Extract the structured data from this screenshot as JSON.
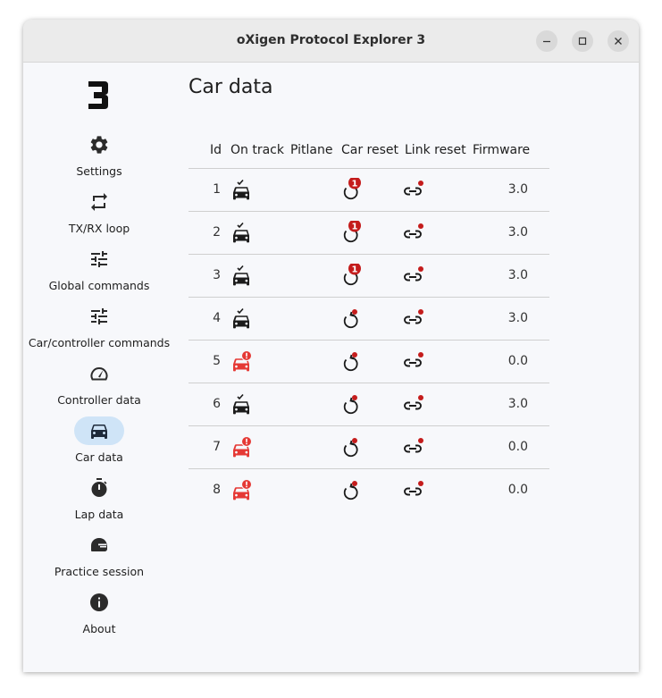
{
  "window": {
    "title": "oXigen Protocol Explorer 3"
  },
  "sidebar": {
    "items": [
      {
        "label": "Settings",
        "icon": "gear-icon"
      },
      {
        "label": "TX/RX loop",
        "icon": "repeat-icon"
      },
      {
        "label": "Global commands",
        "icon": "sliders-icon"
      },
      {
        "label": "Car/controller commands",
        "icon": "sliders-icon"
      },
      {
        "label": "Controller data",
        "icon": "speedometer-icon"
      },
      {
        "label": "Car data",
        "icon": "car-icon",
        "active": true
      },
      {
        "label": "Lap data",
        "icon": "stopwatch-icon"
      },
      {
        "label": "Practice session",
        "icon": "helmet-icon"
      },
      {
        "label": "About",
        "icon": "info-icon"
      }
    ]
  },
  "main": {
    "title": "Car data",
    "columns": [
      "Id",
      "On track",
      "Pitlane",
      "Car reset",
      "Link reset",
      "Firmware"
    ],
    "rows": [
      {
        "id": "1",
        "on_track": true,
        "car_reset_badge": "1",
        "firmware": "3.0"
      },
      {
        "id": "2",
        "on_track": true,
        "car_reset_badge": "1",
        "firmware": "3.0"
      },
      {
        "id": "3",
        "on_track": true,
        "car_reset_badge": "1",
        "firmware": "3.0"
      },
      {
        "id": "4",
        "on_track": true,
        "car_reset_badge": "",
        "firmware": "3.0"
      },
      {
        "id": "5",
        "on_track": false,
        "car_reset_badge": "",
        "firmware": "0.0"
      },
      {
        "id": "6",
        "on_track": true,
        "car_reset_badge": "",
        "firmware": "3.0"
      },
      {
        "id": "7",
        "on_track": false,
        "car_reset_badge": "",
        "firmware": "0.0"
      },
      {
        "id": "8",
        "on_track": false,
        "car_reset_badge": "",
        "firmware": "0.0"
      }
    ]
  },
  "colors": {
    "active_pill": "#cfe4f7",
    "badge_red": "#c41c1c",
    "error_red": "#e53935",
    "text": "#1e1e1e"
  }
}
